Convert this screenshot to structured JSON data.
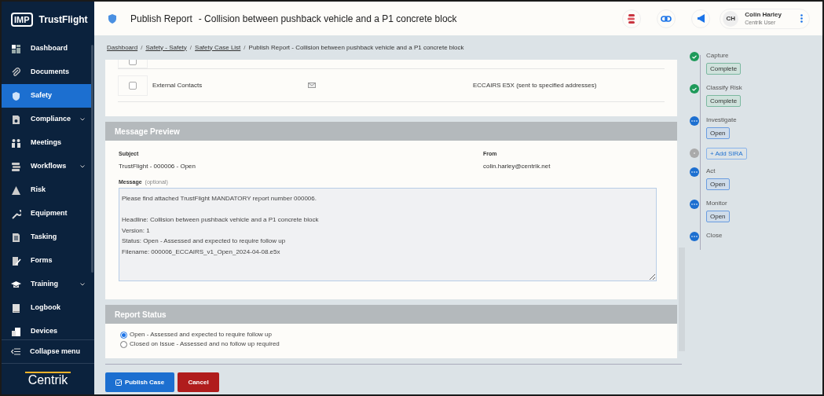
{
  "brand": {
    "badge": "IMP",
    "name": "TrustFlight"
  },
  "sidebar": {
    "items": [
      {
        "label": "Dashboard",
        "selected": false,
        "has_submenu": false
      },
      {
        "label": "Documents",
        "selected": false,
        "has_submenu": false
      },
      {
        "label": "Safety",
        "selected": true,
        "has_submenu": false
      },
      {
        "label": "Compliance",
        "selected": false,
        "has_submenu": true
      },
      {
        "label": "Meetings",
        "selected": false,
        "has_submenu": false
      },
      {
        "label": "Workflows",
        "selected": false,
        "has_submenu": true
      },
      {
        "label": "Risk",
        "selected": false,
        "has_submenu": false
      },
      {
        "label": "Equipment",
        "selected": false,
        "has_submenu": false
      },
      {
        "label": "Tasking",
        "selected": false,
        "has_submenu": false
      },
      {
        "label": "Forms",
        "selected": false,
        "has_submenu": false
      },
      {
        "label": "Training",
        "selected": false,
        "has_submenu": true
      },
      {
        "label": "Logbook",
        "selected": false,
        "has_submenu": false
      },
      {
        "label": "Devices",
        "selected": false,
        "has_submenu": false
      }
    ],
    "collapse": "Collapse menu",
    "footer_logo": "Centrik"
  },
  "header": {
    "title": "Publish Report",
    "subtitle": "- Collision between pushback vehicle and a P1 concrete block",
    "user": {
      "initials": "CH",
      "name": "Colin Harley",
      "role": "Centrik User"
    }
  },
  "breadcrumb": [
    {
      "label": "Dashboard",
      "link": true
    },
    {
      "separator": "/"
    },
    {
      "label": "Safety - Safety",
      "link": true
    },
    {
      "separator": "/"
    },
    {
      "label": "Safety Case List",
      "link": true
    },
    {
      "separator": "/"
    },
    {
      "label": "Publish Report - Collision between pushback vehicle and a P1 concrete block",
      "link": false
    }
  ],
  "recipients": [
    {
      "checked": false
    },
    {
      "checked": false,
      "name": "External Contacts",
      "format": "ECCAIRS E5X (sent to specified addresses)"
    }
  ],
  "message_preview": {
    "title": "Message Preview",
    "subject_label": "Subject",
    "subject": "TrustFlight - 000006 - Open",
    "from_label": "From",
    "from": "colin.harley@centrik.net",
    "message_label": "Message",
    "message_hint": "(optional)",
    "message": "Please find attached TrustFlight MANDATORY report number 000006.\n\nHeadline: Collision between pushback vehicle and a P1 concrete block\nVersion: 1\nStatus: Open - Assessed and expected to require follow up\nFilename: 000006_ECCAIRS_v1_Open_2024-04-08.e5x"
  },
  "report_status": {
    "title": "Report Status",
    "options": [
      {
        "label": "Open - Assessed and expected to require follow up",
        "selected": true
      },
      {
        "label": "Closed on Issue - Assessed and no follow up required",
        "selected": false
      }
    ]
  },
  "actions": [
    {
      "label": "Publish Case",
      "kind": "primary"
    },
    {
      "label": "Cancel",
      "kind": "danger"
    }
  ],
  "workflow": [
    {
      "kind": "complete",
      "label": "Capture",
      "button": "Complete"
    },
    {
      "kind": "complete",
      "label": "Classify Risk",
      "button": "Complete"
    },
    {
      "kind": "open",
      "label": "Investigate",
      "button": "Open"
    },
    {
      "kind": "add",
      "button": "+ Add SIRA"
    },
    {
      "kind": "open",
      "label": "Act",
      "button": "Open"
    },
    {
      "kind": "open",
      "label": "Monitor",
      "button": "Open"
    },
    {
      "kind": "open",
      "label": "Close"
    }
  ]
}
